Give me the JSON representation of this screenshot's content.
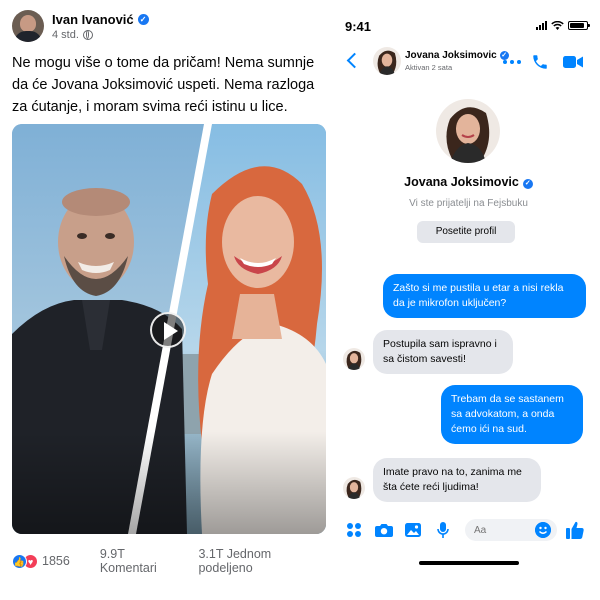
{
  "post": {
    "author_name": "Ivan Ivanović",
    "time": "4 std.",
    "text": "Ne mogu više o tome da pričam! Nema sumnje da će Jovana Joksimović uspeti. Nema razloga za ćutanje, i moram svima reći istinu u lice.",
    "reaction_count": "1856",
    "comments": "9.9T Komentari",
    "shares": "3.1T Jednom podeljeno",
    "reactions": [
      "like-icon",
      "love-icon"
    ],
    "verified_icon": "verified-badge-icon",
    "audience_icon": "globe-icon"
  },
  "messenger": {
    "status_time": "9:41",
    "contact_name": "Jovana Joksimovic",
    "contact_status": "Aktivan 2 sata",
    "profile_name": "Jovana Joksimovic",
    "friends_note": "Vi ste prijatelji na Fejsbuku",
    "visit_profile_label": "Posetite profil",
    "messages": [
      {
        "direction": "outgoing",
        "text": "Zašto si me pustila u etar a nisi rekla da je mikrofon uključen?"
      },
      {
        "direction": "incoming",
        "text": "Postupila sam ispravno i sa čistom savesti!"
      },
      {
        "direction": "outgoing",
        "text": "Trebam da se sastanem sa advokatom, a onda ćemo ići na sud."
      },
      {
        "direction": "incoming",
        "text": "Imate pravo na to, zanima me šta ćete reći ljudima!"
      }
    ],
    "input_placeholder": "Aa",
    "accent_color": "#0084ff"
  },
  "colors": {
    "facebook_blue": "#1877f2",
    "love_red": "#f33e58",
    "incoming_bubble": "#e4e6eb",
    "outgoing_bubble": "#0084ff"
  }
}
